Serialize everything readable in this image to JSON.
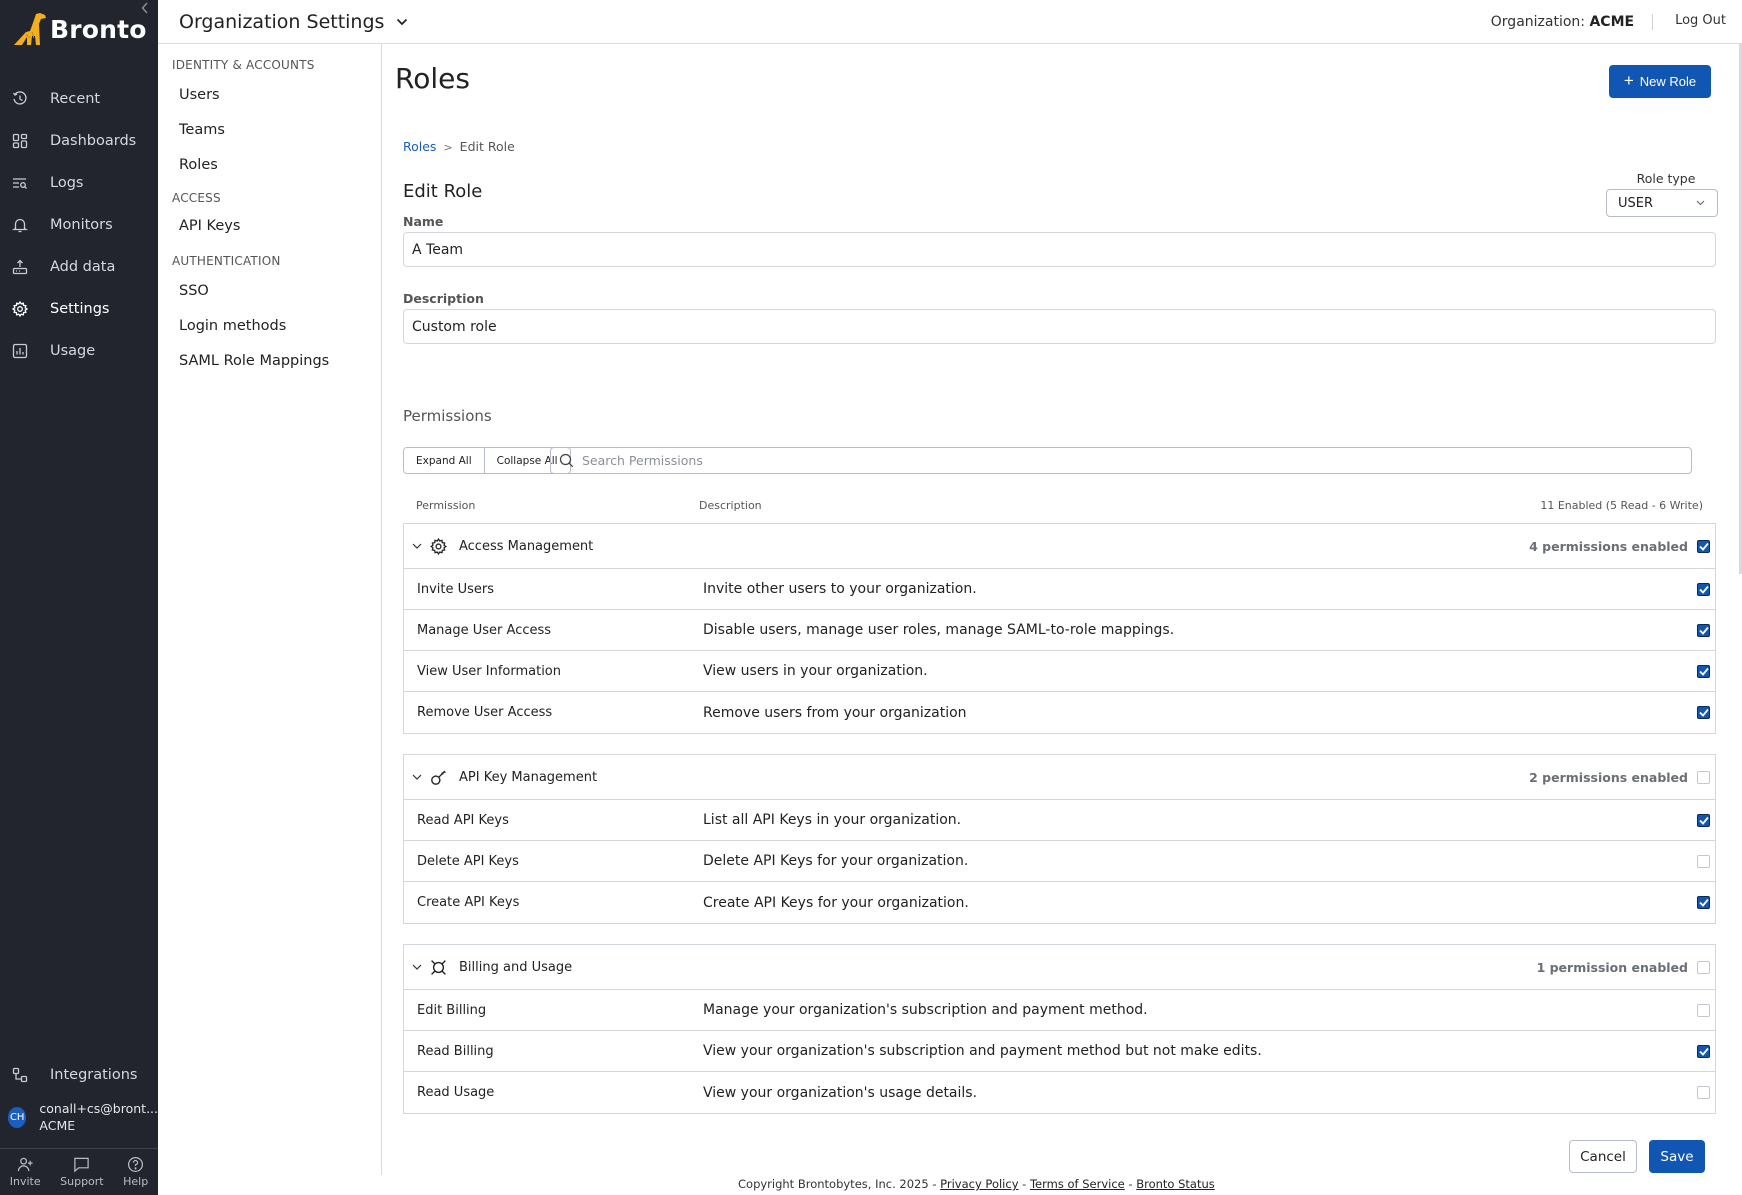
{
  "app": {
    "brand": "Bronto",
    "brand_color": "#f2b01e",
    "accent_color": "#1256b3"
  },
  "sidebar": {
    "collapse_icon": "chevron-left-icon",
    "items": [
      {
        "label": "Recent",
        "icon": "history-icon"
      },
      {
        "label": "Dashboards",
        "icon": "dashboard-grid-icon"
      },
      {
        "label": "Logs",
        "icon": "logs-search-icon"
      },
      {
        "label": "Monitors",
        "icon": "bell-icon"
      },
      {
        "label": "Add data",
        "icon": "upload-tray-icon"
      },
      {
        "label": "Settings",
        "icon": "gear-icon",
        "active": true
      },
      {
        "label": "Usage",
        "icon": "chart-icon"
      }
    ],
    "integrations": {
      "label": "Integrations",
      "icon": "integrations-icon"
    },
    "user": {
      "initials": "CH",
      "email": "conall+cs@bront...",
      "org": "ACME"
    },
    "footer": [
      {
        "label": "Invite",
        "icon": "add-user-icon"
      },
      {
        "label": "Support",
        "icon": "chat-icon"
      },
      {
        "label": "Help",
        "icon": "help-circle-icon"
      }
    ]
  },
  "header": {
    "title": "Organization Settings",
    "org_prefix": "Organization:",
    "org_name": "ACME",
    "logout": "Log Out"
  },
  "subnav": {
    "sections": [
      {
        "title": "IDENTITY & ACCOUNTS",
        "items": [
          "Users",
          "Teams",
          "Roles"
        ]
      },
      {
        "title": "ACCESS",
        "items": [
          "API Keys"
        ]
      },
      {
        "title": "AUTHENTICATION",
        "items": [
          "SSO",
          "Login methods",
          "SAML Role Mappings"
        ]
      }
    ]
  },
  "main": {
    "page_title": "Roles",
    "new_role_button": "New Role",
    "breadcrumb": {
      "root": "Roles",
      "separator": ">",
      "current": "Edit Role"
    },
    "edit_title": "Edit Role",
    "role_type": {
      "label": "Role type",
      "value": "USER"
    },
    "name": {
      "label": "Name",
      "value": "A Team"
    },
    "description": {
      "label": "Description",
      "value": "Custom role"
    },
    "permissions": {
      "title": "Permissions",
      "expand_all": "Expand All",
      "collapse_all": "Collapse All",
      "search_placeholder": "Search Permissions",
      "columns": {
        "permission": "Permission",
        "description": "Description",
        "summary": "11 Enabled (5 Read - 6 Write)"
      },
      "groups": [
        {
          "name": "Access Management",
          "icon": "gear-icon",
          "count_label": "4 permissions enabled",
          "all_checked": true,
          "rows": [
            {
              "name": "Invite Users",
              "description": "Invite other users to your organization.",
              "checked": true
            },
            {
              "name": "Manage User Access",
              "description": "Disable users, manage user roles, manage SAML-to-role mappings.",
              "checked": true
            },
            {
              "name": "View User Information",
              "description": "View users in your organization.",
              "checked": true
            },
            {
              "name": "Remove User Access",
              "description": "Remove users from your organization",
              "checked": true
            }
          ]
        },
        {
          "name": "API Key Management",
          "icon": "key-icon",
          "count_label": "2 permissions enabled",
          "all_checked": false,
          "rows": [
            {
              "name": "Read API Keys",
              "description": "List all API Keys in your organization.",
              "checked": true
            },
            {
              "name": "Delete API Keys",
              "description": "Delete API Keys for your organization.",
              "checked": false
            },
            {
              "name": "Create API Keys",
              "description": "Create API Keys for your organization.",
              "checked": true
            }
          ]
        },
        {
          "name": "Billing and Usage",
          "icon": "currency-icon",
          "count_label": "1 permission enabled",
          "all_checked": false,
          "rows": [
            {
              "name": "Edit Billing",
              "description": "Manage your organization's subscription and payment method.",
              "checked": false
            },
            {
              "name": "Read Billing",
              "description": "View your organization's subscription and payment method but not make edits.",
              "checked": true
            },
            {
              "name": "Read Usage",
              "description": "View your organization's usage details.",
              "checked": false
            }
          ]
        }
      ]
    },
    "cancel": "Cancel",
    "save": "Save"
  },
  "footer": {
    "copyright": "Copyright Brontobytes, Inc. 2025",
    "sep": "-",
    "links": [
      "Privacy Policy",
      "Terms of Service",
      "Bronto Status"
    ]
  }
}
